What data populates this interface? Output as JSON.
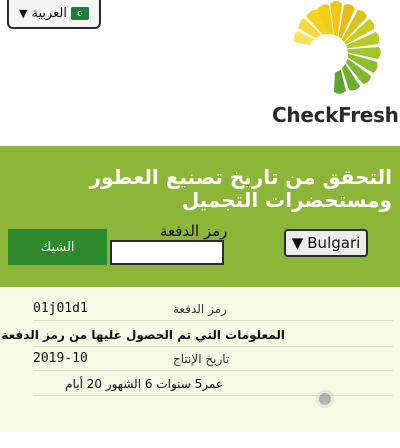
{
  "header": {
    "language_label": "العربية",
    "language_caret": "▼",
    "flag_label": "☪",
    "brand_name": "CheckFresh"
  },
  "main": {
    "title": "التحقق من تاريخ تصنيع العطور ومستحضرات التجميل",
    "brand_select_value": "Bulgari",
    "brand_caret": "▼",
    "batch_code_label": "رمز الدفعة",
    "batch_code_value": "",
    "check_button_label": "الشيك"
  },
  "results": {
    "batch_code_label": "رمز الدفعة",
    "batch_code_value": "01j01d1",
    "info_heading": "المعلومات التي تم الحصول عليها من رمز الدفعة",
    "production_date_label": "تاريخ الإنتاج",
    "production_date_value": "2019-10",
    "age_text": "عمر5 سنوات 6 الشهور 20 أيام"
  },
  "colors": {
    "green_band": "#8db538",
    "check_button": "#2c8a2d",
    "results_bg": "#f6f9e4"
  }
}
